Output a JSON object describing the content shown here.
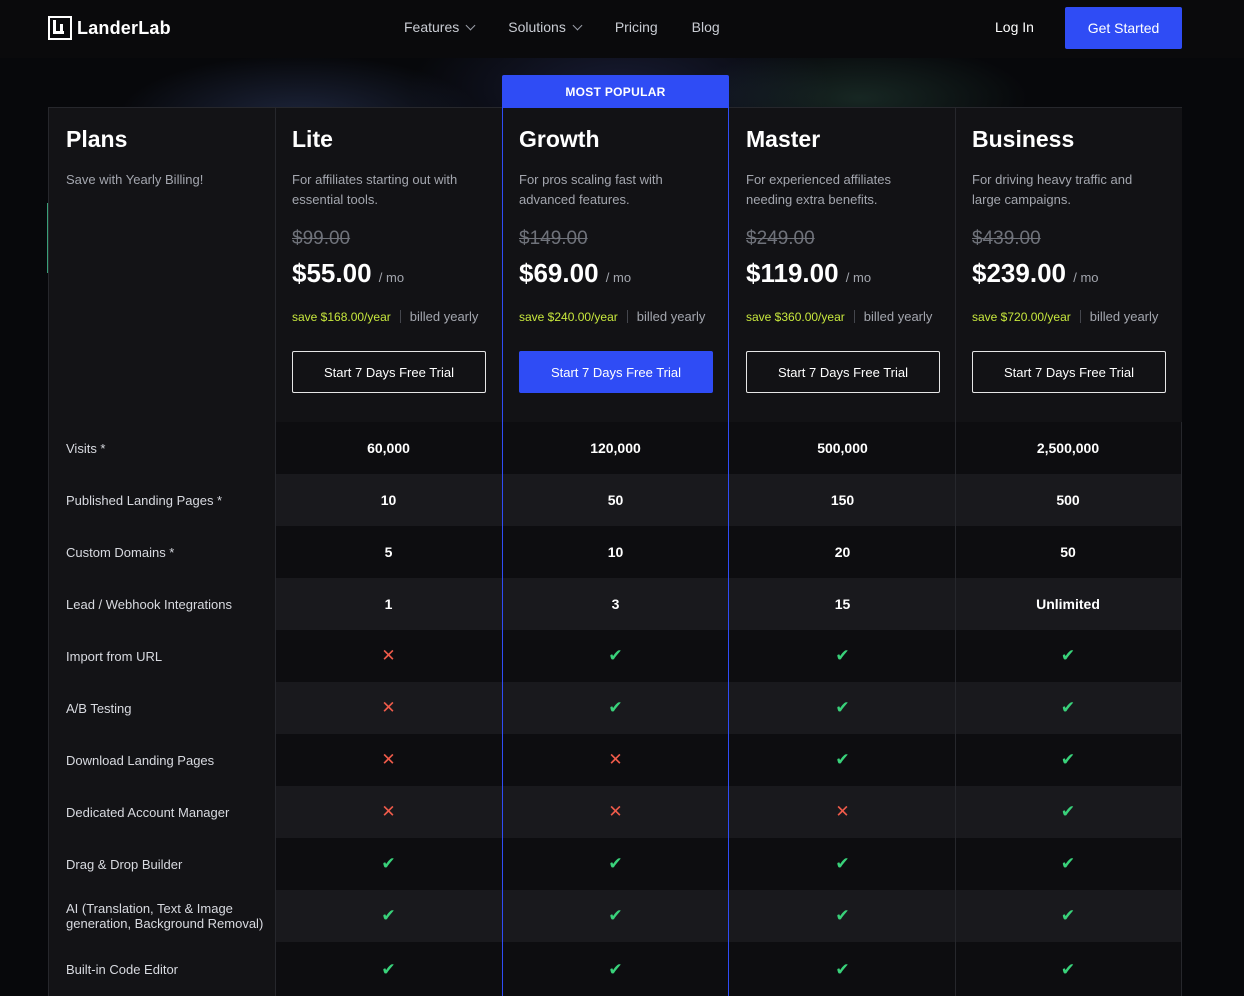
{
  "nav": {
    "brand": "LanderLab",
    "links": [
      {
        "label": "Features",
        "dropdown": true
      },
      {
        "label": "Solutions",
        "dropdown": true
      },
      {
        "label": "Pricing",
        "dropdown": false
      },
      {
        "label": "Blog",
        "dropdown": false
      }
    ],
    "login": "Log In",
    "cta": "Get Started"
  },
  "plans_header": {
    "title": "Plans",
    "subtitle": "Save with Yearly Billing!"
  },
  "badge": "MOST POPULAR",
  "plans": [
    {
      "name": "Lite",
      "desc": "For affiliates starting out with essential tools.",
      "old_price": "$99.00",
      "price": "$55.00",
      "per": "/ mo",
      "save": "save $168.00/year",
      "billed": "billed yearly",
      "cta": "Start 7 Days Free Trial",
      "primary": false
    },
    {
      "name": "Growth",
      "desc": "For pros scaling fast with advanced features.",
      "old_price": "$149.00",
      "price": "$69.00",
      "per": "/ mo",
      "save": "save $240.00/year",
      "billed": "billed yearly",
      "cta": "Start 7 Days Free Trial",
      "primary": true
    },
    {
      "name": "Master",
      "desc": "For experienced affiliates needing extra benefits.",
      "old_price": "$249.00",
      "price": "$119.00",
      "per": "/ mo",
      "save": "save $360.00/year",
      "billed": "billed yearly",
      "cta": "Start 7 Days Free Trial",
      "primary": false
    },
    {
      "name": "Business",
      "desc": "For driving heavy traffic and large campaigns.",
      "old_price": "$439.00",
      "price": "$239.00",
      "per": "/ mo",
      "save": "save $720.00/year",
      "billed": "billed yearly",
      "cta": "Start 7 Days Free Trial",
      "primary": false
    }
  ],
  "features": [
    {
      "label": "Visits *",
      "values": [
        "60,000",
        "120,000",
        "500,000",
        "2,500,000"
      ]
    },
    {
      "label": "Published Landing Pages *",
      "values": [
        "10",
        "50",
        "150",
        "500"
      ]
    },
    {
      "label": "Custom Domains *",
      "values": [
        "5",
        "10",
        "20",
        "50"
      ]
    },
    {
      "label": "Lead / Webhook Integrations",
      "values": [
        "1",
        "3",
        "15",
        "Unlimited"
      ]
    },
    {
      "label": "Import from URL",
      "values": [
        "no",
        "yes",
        "yes",
        "yes"
      ]
    },
    {
      "label": "A/B Testing",
      "values": [
        "no",
        "yes",
        "yes",
        "yes"
      ]
    },
    {
      "label": "Download Landing Pages",
      "values": [
        "no",
        "no",
        "yes",
        "yes"
      ]
    },
    {
      "label": "Dedicated Account Manager",
      "values": [
        "no",
        "no",
        "no",
        "yes"
      ]
    },
    {
      "label": "Drag & Drop Builder",
      "values": [
        "yes",
        "yes",
        "yes",
        "yes"
      ]
    },
    {
      "label": "AI (Translation, Text & Image generation, Background Removal)",
      "values": [
        "yes",
        "yes",
        "yes",
        "yes"
      ]
    },
    {
      "label": "Built-in Code Editor",
      "values": [
        "yes",
        "yes",
        "yes",
        "yes"
      ]
    }
  ],
  "colors": {
    "accent": "#2f4cf5",
    "check": "#39d17a",
    "cross": "#ef5b4a",
    "save": "#c7e73d"
  }
}
